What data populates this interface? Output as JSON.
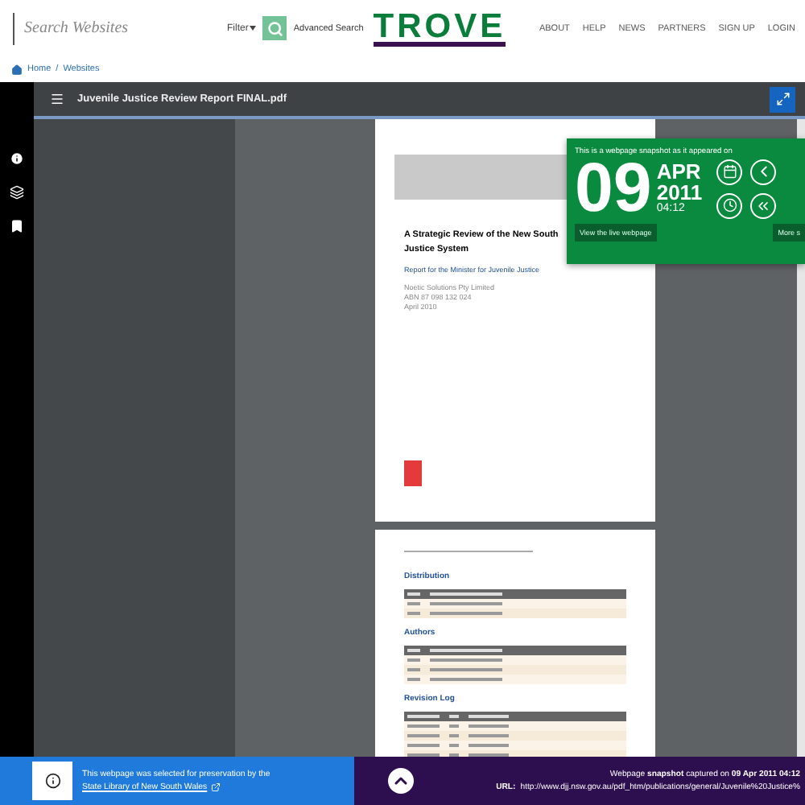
{
  "header": {
    "search": {
      "placeholder": "Search Websites"
    },
    "filter": "Filter",
    "advanced_search": "Advanced Search",
    "logo": "TROVE",
    "nav": [
      "ABOUT",
      "HELP",
      "NEWS",
      "PARTNERS",
      "SIGN UP",
      "LOGIN"
    ]
  },
  "breadcrumb": {
    "items": [
      "Home",
      "Websites"
    ],
    "separator": "/"
  },
  "viewer": {
    "title": "Juvenile Justice Review Report FINAL.pdf",
    "page_1": {
      "title_lines": [
        "A Strategic Review of the New South",
        "Justice System"
      ],
      "subtitle": "Report for the Minister for Juvenile Justice",
      "details": [
        "Noetic Solutions Pty Limited",
        "ABN 87 098 132 024",
        "April 2010"
      ]
    },
    "page_2": {
      "sections": [
        {
          "heading": "Distribution"
        },
        {
          "heading": "Authors"
        },
        {
          "heading": "Revision Log"
        }
      ]
    }
  },
  "snapshot_popup": {
    "caption": "This is a webpage snapshot as it appeared on",
    "day": "09",
    "month": "APR",
    "year": "2011",
    "time": "04:12",
    "live_button": "View the live webpage",
    "more_button": "More s"
  },
  "footer": {
    "selected_text": "This webpage was selected for preservation by the",
    "library_link": "State Library of New South Wales",
    "capture_text": "Webpage **snapshot** captured on **09 Apr 2011 04:12**",
    "url_label": "URL:",
    "url": "http://www.djj.nsw.gov.au/pdf_htm/publications/general/Juvenile%20Justice%"
  }
}
